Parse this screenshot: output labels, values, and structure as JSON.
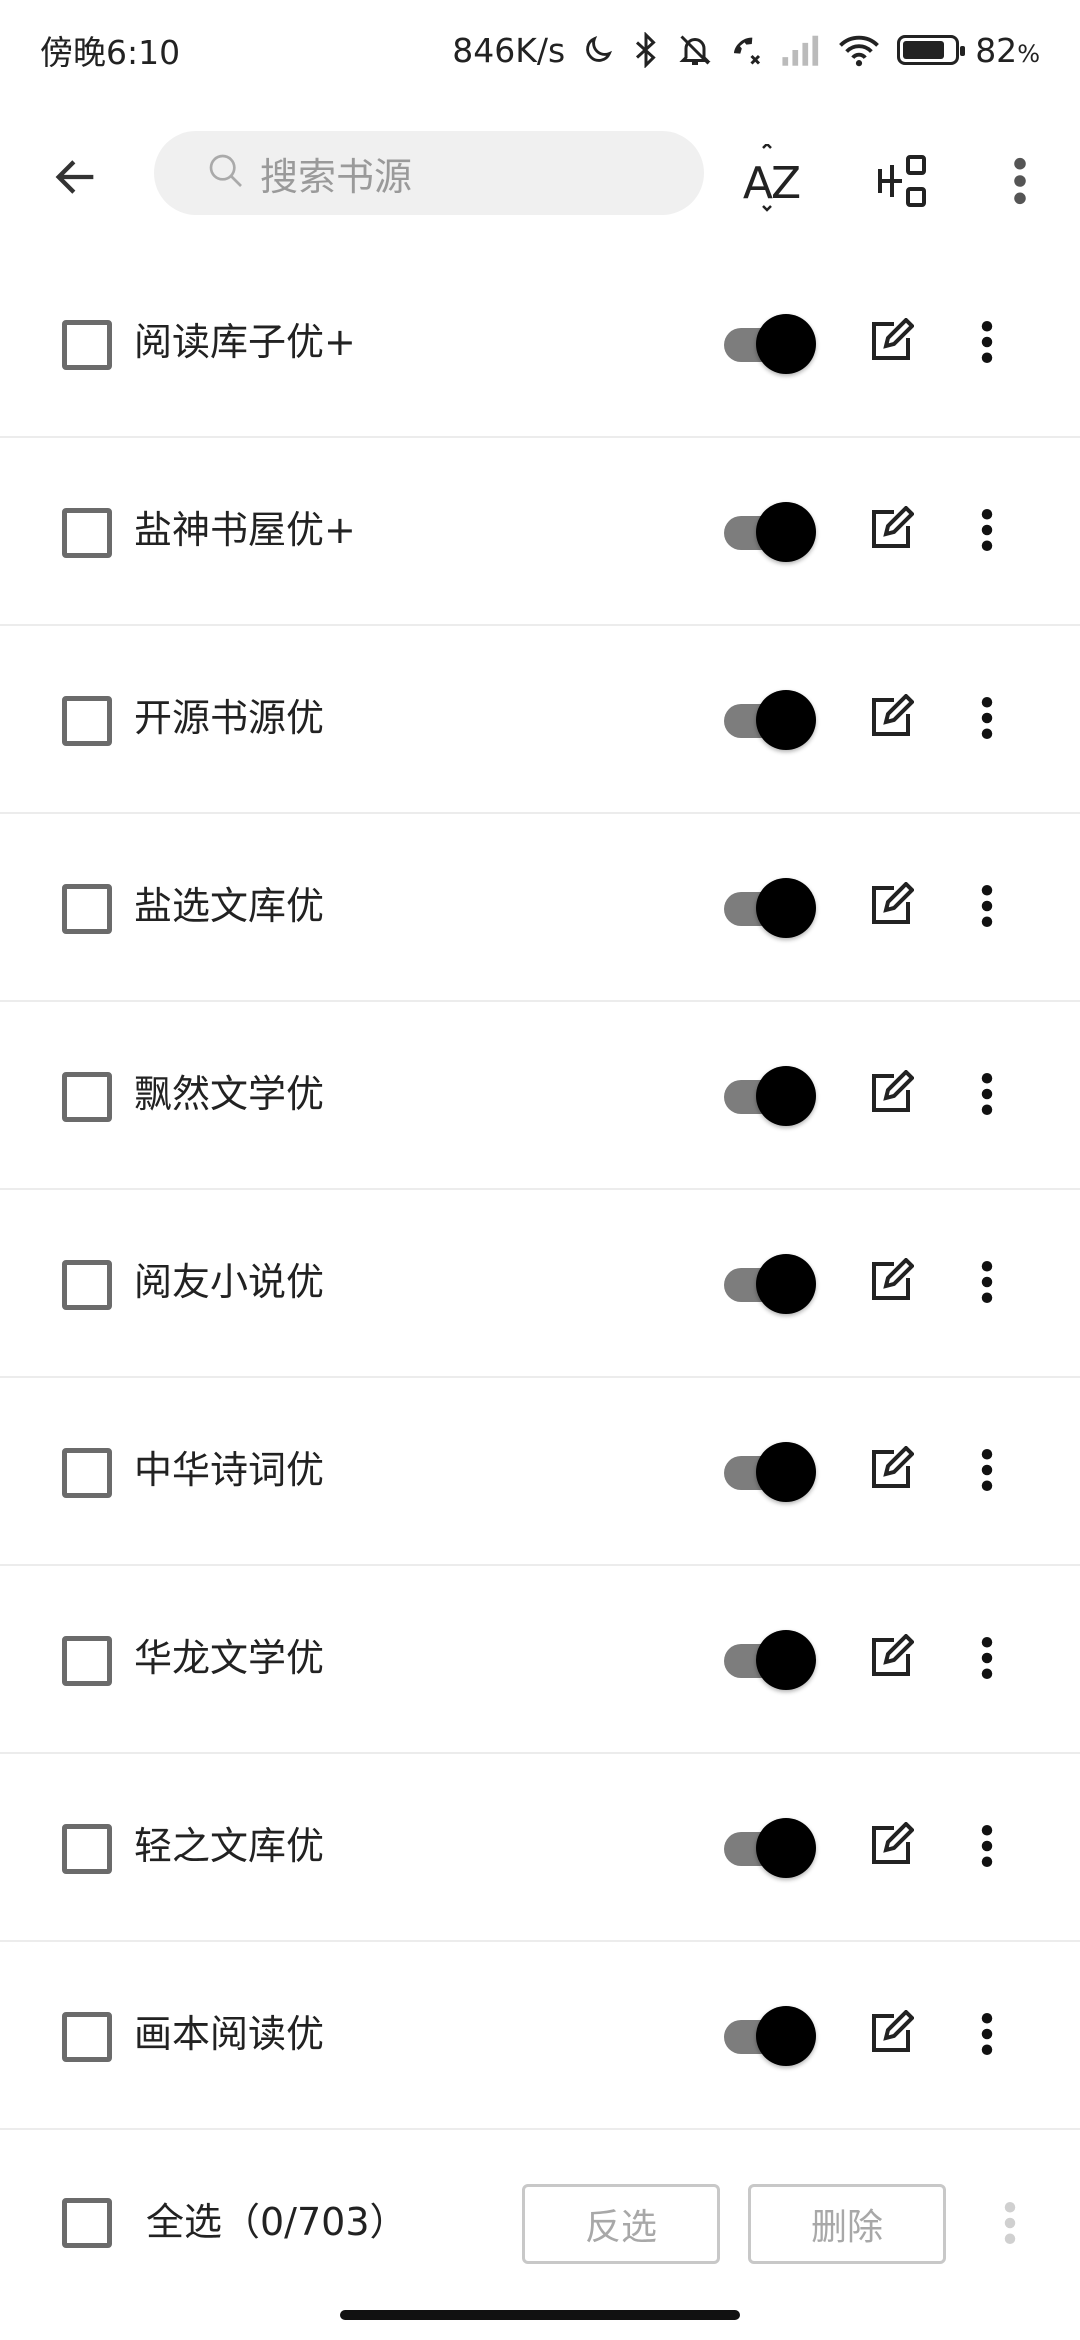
{
  "status_bar": {
    "time": "傍晚6:10",
    "network_speed": "846K/s",
    "battery_percent": "82",
    "battery_unit": "%",
    "battery_level": 0.82,
    "icons": [
      "moon-icon",
      "bluetooth-icon",
      "silent-bell-icon",
      "call-off-icon",
      "cellular-signal-icon",
      "wifi-icon",
      "battery-icon"
    ]
  },
  "toolbar": {
    "search_placeholder": "搜索书源",
    "sort_label": "AZ",
    "icons": [
      "back-arrow-icon",
      "search-icon",
      "sort-az-icon",
      "group-icon",
      "more-vert-icon"
    ]
  },
  "sources": [
    {
      "name": "阅读库子优+",
      "enabled": true,
      "checked": false
    },
    {
      "name": "盐神书屋优+",
      "enabled": true,
      "checked": false
    },
    {
      "name": "开源书源优",
      "enabled": true,
      "checked": false
    },
    {
      "name": "盐选文库优",
      "enabled": true,
      "checked": false
    },
    {
      "name": "飘然文学优",
      "enabled": true,
      "checked": false
    },
    {
      "name": "阅友小说优",
      "enabled": true,
      "checked": false
    },
    {
      "name": "中华诗词优",
      "enabled": true,
      "checked": false
    },
    {
      "name": "华龙文学优",
      "enabled": true,
      "checked": false
    },
    {
      "name": "轻之文库优",
      "enabled": true,
      "checked": false
    },
    {
      "name": "画本阅读优",
      "enabled": true,
      "checked": false
    }
  ],
  "bottom_bar": {
    "select_all_label": "全选（0/703）",
    "invert_label": "反选",
    "delete_label": "删除"
  },
  "colors": {
    "switch_track": "#7d7d7d",
    "switch_thumb": "#000000",
    "search_bg": "#f0f0f0",
    "divider": "#ececec"
  }
}
